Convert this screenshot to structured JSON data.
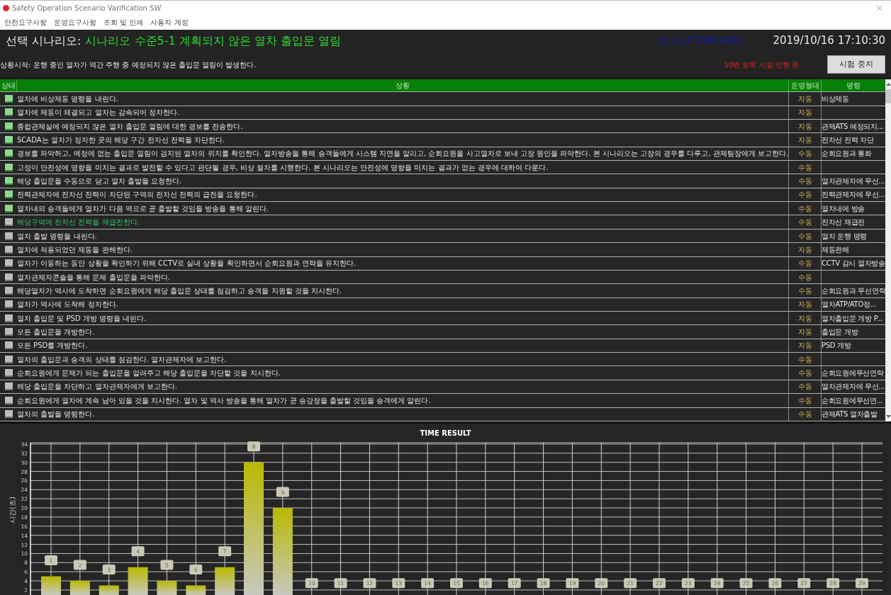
{
  "window": {
    "title": "Safety Operation Scenario Varification SW"
  },
  "menu": [
    "안전요구사항",
    "운영요구사항",
    "조회 및 인쇄",
    "사용자 계정"
  ],
  "header": {
    "scenario_label": "선택 시나리오:",
    "scenario_name": "시나리오 수준5-1 계획되지 않은 열차 출입문 열림",
    "login": "로그인(TMPUSER)",
    "datetime": "2019/10/16 17:10:30",
    "description": "상황시작: 운행 중인 열차가 역간 주행 중 예정되지 않은 출입문 열림이 발생한다.",
    "progress": "10번 항목 시험 진행 중",
    "stop_button": "시험 중지"
  },
  "table": {
    "columns": [
      "상태",
      "상황",
      "운영형태",
      "명령"
    ],
    "rows": [
      {
        "situation": "열차에 비상제동 명령을 내린다.",
        "mode": "자동",
        "command": "비상제동",
        "done": true,
        "current": false
      },
      {
        "situation": "열차에 제동이 체결되고 열차는 감속되어 정차한다.",
        "mode": "자동",
        "done": true,
        "current": false
      },
      {
        "situation": "종합관제실에 예정되지 않은 열차 출입문 열림에 대한 경보를 전송한다.",
        "mode": "자동",
        "command": "관제ATS 예정되지...",
        "done": true,
        "current": false
      },
      {
        "situation": "SCADA는 열차가 정차한 곳의 해당 구간 전차선 전력을 차단한다.",
        "mode": "자동",
        "command": "전차선 전력 차단",
        "done": true,
        "current": false
      },
      {
        "situation": "경보를 파악하고, 예정에 없는 출입문 열림이 검지된 열차의 위치를 확인한다. 열차방송을 통해 승객들에게 시스템 지연을 알리고, 순회요원을 사고열차로 보내 고장 원인을 파악한다. 본 시나리오는 고장의 경우를 다루고, 관제팀장에게 보고한다.",
        "mode": "수동",
        "command": "순회요원과 통화",
        "done": true,
        "current": false
      },
      {
        "situation": "고장이 안전성에 영향을 미치는 결과로 발전할 수 있다고 판단될 경우, 비상 절차를 시행한다. 본 시나리오는 안전성에 영향을 미치는 결과가 없는 경우에 대하여 다룬다.",
        "mode": "수동",
        "done": true,
        "current": false
      },
      {
        "situation": "해당 출입문을 수동으로 닫고 열차 출발을 요청한다.",
        "mode": "수동",
        "command": "열차관제자에 무선...",
        "done": true,
        "current": false
      },
      {
        "situation": "전력관제자에 전차선 전력이 차단된 구역의 전차선 전력의 급전을 요청한다.",
        "mode": "수동",
        "command": "전력관제자에 무선...",
        "done": true,
        "current": false
      },
      {
        "situation": "열차내의 승객들에게 열차가 다음 역으로 곧 출발할 것임을 방송을 통해 알린다.",
        "mode": "수동",
        "command": "열차내에 방송",
        "done": true,
        "current": false
      },
      {
        "situation": "해당구역에 전차선 전력을 재급전한다.",
        "mode": "수동",
        "command": "전차선 재급전",
        "done": false,
        "current": true
      },
      {
        "situation": "열차 출발 명령을 내린다.",
        "mode": "수동",
        "command": "열차 운행 명령",
        "done": false,
        "current": false
      },
      {
        "situation": "열차에 적용되었던 제동을 완해한다.",
        "mode": "자동",
        "command": "제동완해",
        "done": false,
        "current": false
      },
      {
        "situation": "열차가 이동하는 동안 상황을 확인하기 위해 CCTV로 실내 상황을 확인하면서 순회요원과 연락을 유지한다.",
        "mode": "수동",
        "command": "CCTV 감시 열차방송",
        "done": false,
        "current": false
      },
      {
        "situation": "열차관제자콘솔을 통해 문제 출입문을 파악한다.",
        "mode": "수동",
        "done": false,
        "current": false
      },
      {
        "situation": "해당열차가 역사에 도착하면 순회요원에게 해당 출입문 상태를 점검하고 승객을 지원할 것을 지시한다.",
        "mode": "수동",
        "command": "순회요원과 무선연락",
        "done": false,
        "current": false
      },
      {
        "situation": "열차가 역사에 도착해 정차한다.",
        "mode": "자동",
        "command": "열차ATP/ATO정...",
        "done": false,
        "current": false
      },
      {
        "situation": "열차 출입문 및 PSD 개방 명령을 내린다.",
        "mode": "자동",
        "command": "열차출입문 개방 P...",
        "done": false,
        "current": false
      },
      {
        "situation": "모든 출입문을 개방한다.",
        "mode": "자동",
        "command": "출입문 개방",
        "done": false,
        "current": false
      },
      {
        "situation": "모든 PSD를 개방한다.",
        "mode": "자동",
        "command": "PSD 개방",
        "done": false,
        "current": false
      },
      {
        "situation": "열차의 출입문과 승객의 상태를 점검한다. 열차관제자에 보고한다.",
        "mode": "수동",
        "done": false,
        "current": false
      },
      {
        "situation": "순회요원에게 문제가 되는 출입문을 알려주고 해당 출입문을 차단할 것을 지시한다.",
        "mode": "수동",
        "command": "순회요원에무선연락",
        "done": false,
        "current": false
      },
      {
        "situation": "해당 출입문을 차단하고 열차관제자에게 보고한다.",
        "mode": "수동",
        "command": "열차관제자에 무선...",
        "done": false,
        "current": false
      },
      {
        "situation": "순회요원에게 열차에 계속 남아 있을 것을 지시한다. 열차 및 역사 방송을 통해 열차가 곧 승강장을 출발할 것임을 승객에게 알린다.",
        "mode": "수동",
        "command": "순회요원에무선연...",
        "done": false,
        "current": false
      },
      {
        "situation": "열차의 출발을 명령한다.",
        "mode": "수동",
        "command": "관제ATS 열차출발",
        "done": false,
        "current": false
      }
    ]
  },
  "chart": {
    "chart_data": {
      "type": "bar",
      "title": "TIME RESULT",
      "ylabel": "시간(초)",
      "categories": [
        "1",
        "2",
        "3",
        "4",
        "5",
        "6",
        "7",
        "8",
        "9",
        "10",
        "11",
        "12",
        "13",
        "14",
        "15",
        "16",
        "17",
        "18",
        "19",
        "20",
        "21",
        "22",
        "23",
        "24",
        "25",
        "26",
        "27",
        "28",
        "29"
      ],
      "values": [
        5,
        4,
        3,
        7,
        4,
        3,
        7,
        30,
        20,
        null,
        null,
        null,
        null,
        null,
        null,
        null,
        null,
        null,
        null,
        null,
        null,
        null,
        null,
        null,
        null,
        null,
        null,
        null,
        null
      ],
      "grid": true,
      "ylim": [
        0.9,
        34.3
      ],
      "yticks": [
        2,
        4,
        6,
        8,
        10,
        12,
        14,
        16,
        18,
        20,
        22,
        24,
        26,
        28,
        30,
        32,
        34
      ]
    }
  }
}
